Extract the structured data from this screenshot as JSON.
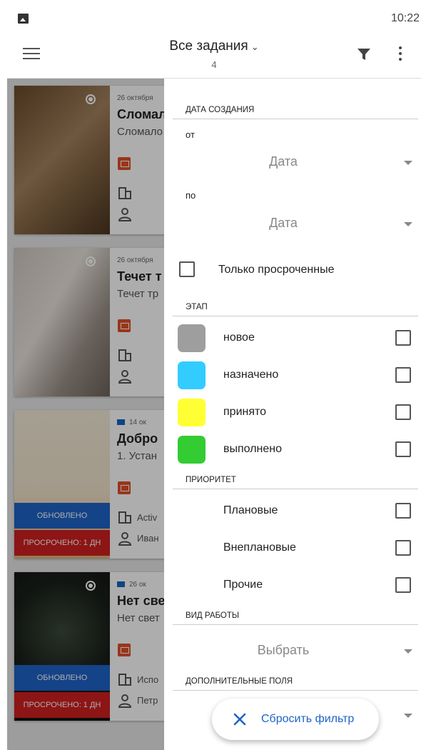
{
  "status": {
    "time": "10:22"
  },
  "appbar": {
    "title": "Все задания",
    "count": "4"
  },
  "tasks": [
    {
      "date": "26 октября",
      "title": "Сломал",
      "subtitle": "Сломало",
      "building": "",
      "person": "",
      "updated": "",
      "overdue": "",
      "mail": false
    },
    {
      "date": "26 октября",
      "title": "Течет т",
      "subtitle": "Течет тр",
      "building": "",
      "person": "",
      "updated": "",
      "overdue": "",
      "mail": false
    },
    {
      "date": "14 ок",
      "title": "Добро",
      "subtitle": "1. Устан",
      "building": "Activ",
      "person": "Иван",
      "updated": "ОБНОВЛЕНО",
      "overdue": "ПРОСРОЧЕНО: 1 ДН",
      "mail": true
    },
    {
      "date": "26 ок",
      "title": "Нет све",
      "subtitle": "Нет свет",
      "building": "Испо",
      "person": "Петр",
      "updated": "ОБНОВЛЕНО",
      "overdue": "ПРОСРОЧЕНО: 1 ДН",
      "mail": true
    }
  ],
  "filter": {
    "created_header": "ДАТА СОЗДАНИЯ",
    "from_label": "от",
    "from_value": "Дата",
    "to_label": "по",
    "to_value": "Дата",
    "overdue_only": "Только просроченные",
    "stage_header": "ЭТАП",
    "stages": [
      {
        "label": "новое",
        "color": "#9e9e9e"
      },
      {
        "label": "назначено",
        "color": "#33ccff"
      },
      {
        "label": "принято",
        "color": "#ffff33"
      },
      {
        "label": "выполнено",
        "color": "#33cc33"
      }
    ],
    "priority_header": "ПРИОРИТЕТ",
    "priorities": [
      "Плановые",
      "Внеплановые",
      "Прочие"
    ],
    "work_type_header": "ВИД РАБОТЫ",
    "work_type_value": "Выбрать",
    "extra_header": "ДОПОЛНИТЕЛЬНЫЕ ПОЛЯ",
    "reset_label": "Сбросить фильтр"
  }
}
